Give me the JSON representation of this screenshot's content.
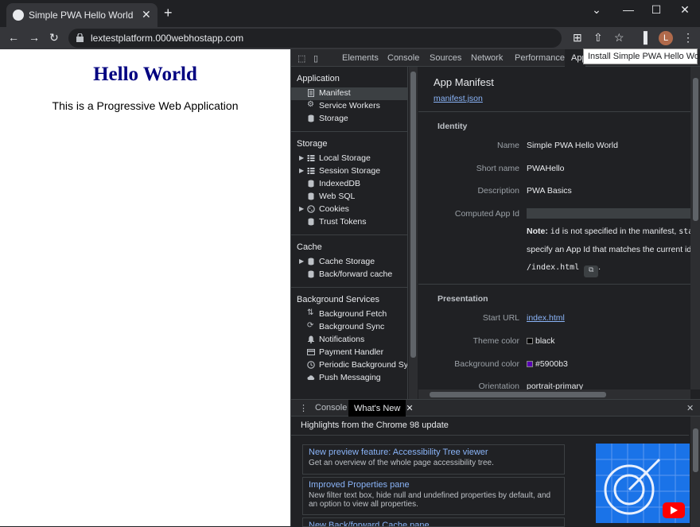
{
  "browser": {
    "tab_title": "Simple PWA Hello World",
    "url": "lextestplatform.000webhostapp.com",
    "avatar_letter": "L",
    "install_tooltip": "Install Simple PWA Hello World"
  },
  "page": {
    "heading": "Hello World",
    "text": "This is a Progressive Web Application"
  },
  "devtools": {
    "tabs": [
      "Elements",
      "Console",
      "Sources",
      "Network",
      "Performance",
      "App"
    ],
    "sidebar": {
      "application_header": "Application",
      "application_items": [
        "Manifest",
        "Service Workers",
        "Storage"
      ],
      "storage_header": "Storage",
      "storage_items": [
        "Local Storage",
        "Session Storage",
        "IndexedDB",
        "Web SQL",
        "Cookies",
        "Trust Tokens"
      ],
      "cache_header": "Cache",
      "cache_items": [
        "Cache Storage",
        "Back/forward cache"
      ],
      "bg_header": "Background Services",
      "bg_items": [
        "Background Fetch",
        "Background Sync",
        "Notifications",
        "Payment Handler",
        "Periodic Background Sync",
        "Push Messaging"
      ]
    },
    "manifest": {
      "title": "App Manifest",
      "link": "manifest.json",
      "identity_header": "Identity",
      "name_label": "Name",
      "name_value": "Simple PWA Hello World",
      "short_label": "Short name",
      "short_value": "PWAHello",
      "desc_label": "Description",
      "desc_value": "PWA Basics",
      "appid_label": "Computed App Id",
      "note_bold": "Note:",
      "note_code1": "id",
      "note_text1": "is not specified in the manifest,",
      "note_code2": "start_",
      "note_line2": "specify an App Id that matches the current identi",
      "note_code3": "/index.html",
      "presentation_header": "Presentation",
      "start_label": "Start URL",
      "start_value": "index.html",
      "theme_label": "Theme color",
      "theme_value": "black",
      "bg_label": "Background color",
      "bg_value": "#5900b3",
      "orient_label": "Orientation",
      "orient_value": "portrait-primary"
    },
    "colors": {
      "theme": "#000000",
      "background": "#5900b3"
    },
    "drawer": {
      "console_tab": "Console",
      "whatsnew_tab": "What's New",
      "heading": "Highlights from the Chrome 98 update",
      "cards": [
        {
          "title": "New preview feature: Accessibility Tree viewer",
          "desc": "Get an overview of the whole page accessibility tree."
        },
        {
          "title": "Improved Properties pane",
          "desc": "New filter text box, hide null and undefined properties by default, and an option to view all properties."
        },
        {
          "title": "New Back/forward Cache pane",
          "desc": ""
        }
      ]
    }
  }
}
